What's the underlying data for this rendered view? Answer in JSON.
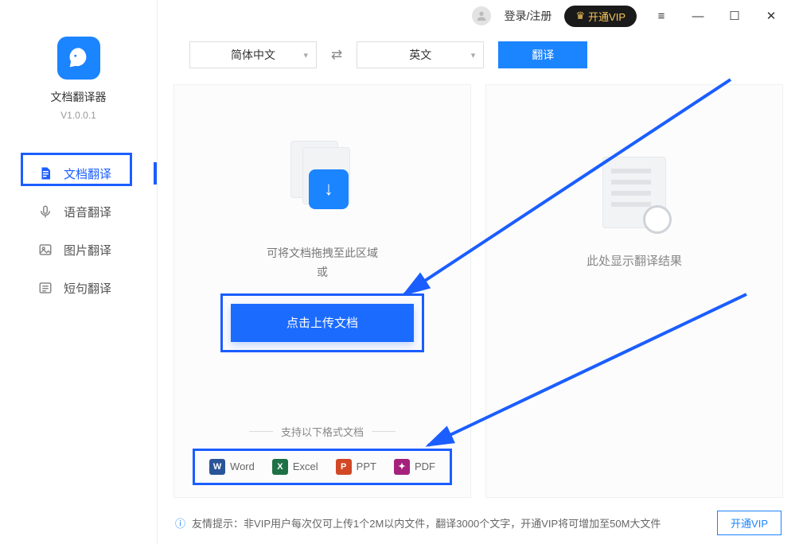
{
  "titlebar": {
    "login": "登录/注册",
    "vip": "开通VIP"
  },
  "app": {
    "name": "文档翻译器",
    "version": "V1.0.0.1"
  },
  "nav": {
    "items": [
      {
        "label": "文档翻译"
      },
      {
        "label": "语音翻译"
      },
      {
        "label": "图片翻译"
      },
      {
        "label": "短句翻译"
      }
    ]
  },
  "langbar": {
    "source": "简体中文",
    "target": "英文",
    "translate": "翻译"
  },
  "upload": {
    "drag_line1": "可将文档拖拽至此区域",
    "or": "或",
    "button": "点击上传文档",
    "formats_title": "支持以下格式文档",
    "formats": {
      "word": "Word",
      "excel": "Excel",
      "ppt": "PPT",
      "pdf": "PDF"
    }
  },
  "result": {
    "placeholder": "此处显示翻译结果"
  },
  "tip": {
    "label": "友情提示：",
    "text": "非VIP用户每次仅可上传1个2M以内文件，翻译3000个文字，开通VIP将可增加至50M大文件",
    "button": "开通VIP"
  }
}
